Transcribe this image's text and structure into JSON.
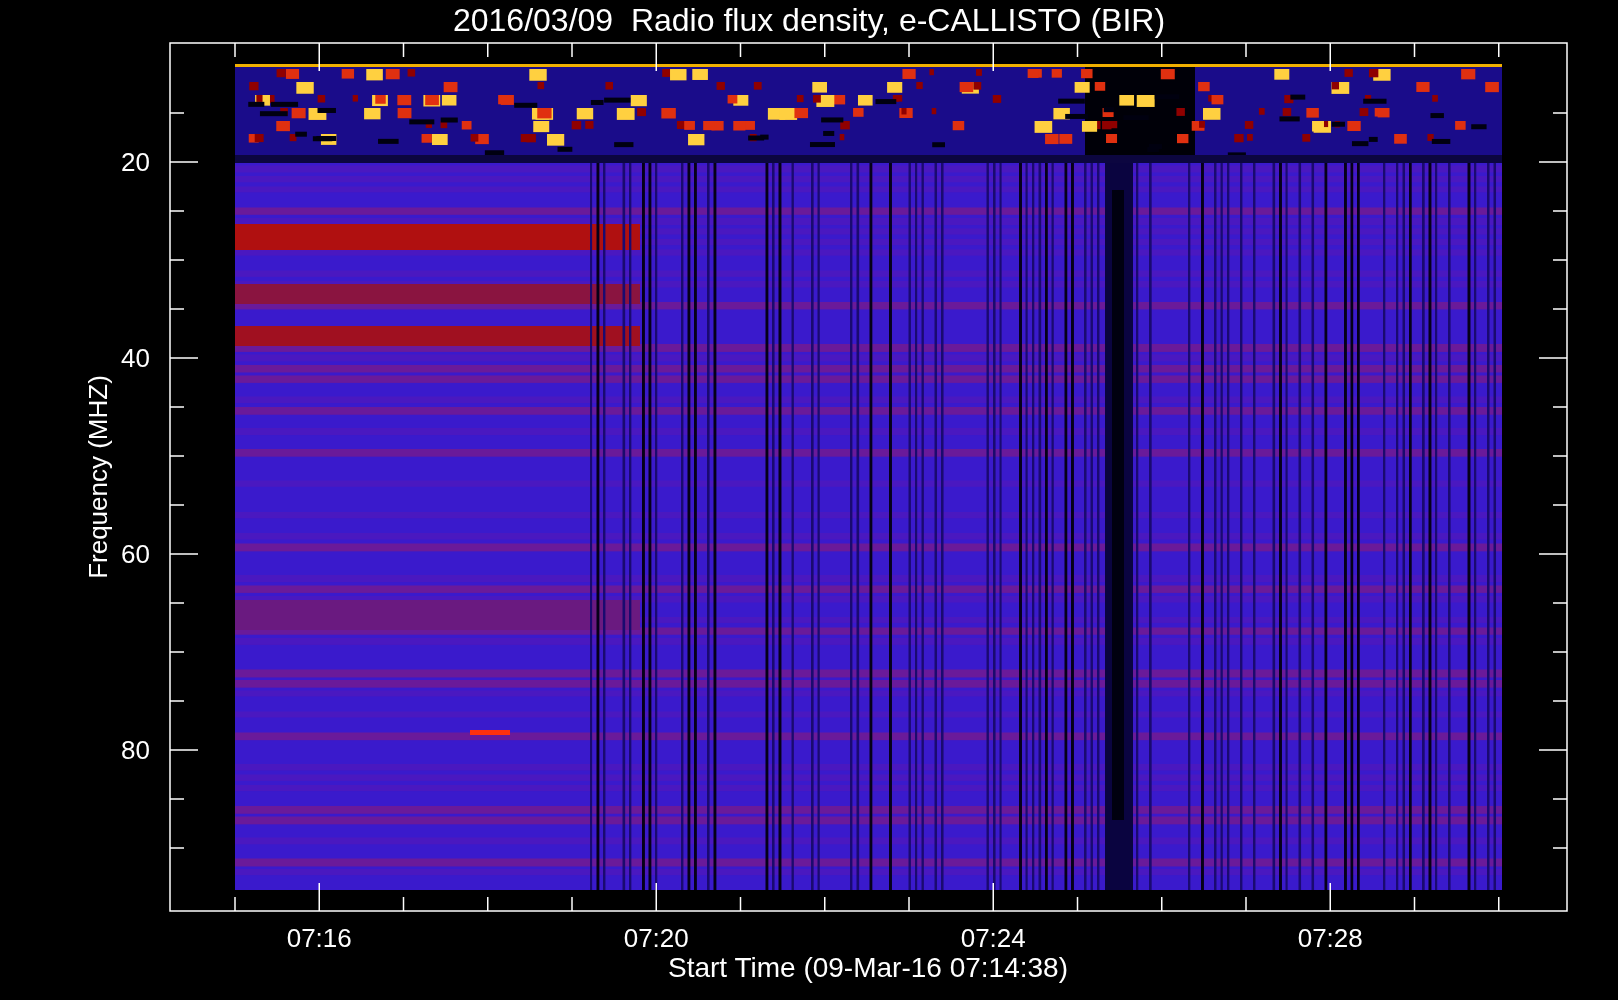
{
  "title": "2016/03/09  Radio flux density, e-CALLISTO (BIR)",
  "xlabel": "Start Time (09-Mar-16 07:14:38)",
  "ylabel": "Frequency (MHZ)",
  "xticks": [
    "07:16",
    "07:20",
    "07:24",
    "07:28"
  ],
  "yticks": [
    "20",
    "40",
    "60",
    "80"
  ]
}
